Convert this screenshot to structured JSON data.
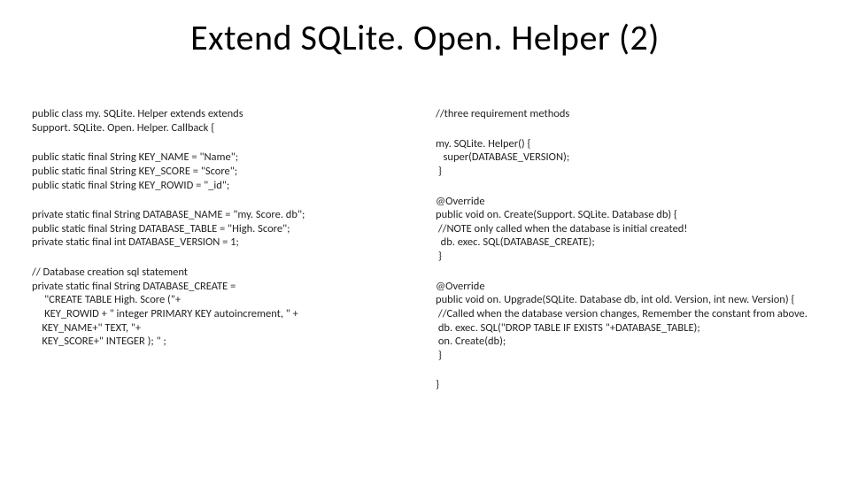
{
  "slide": {
    "title": "Extend SQLite. Open. Helper (2)",
    "left": {
      "p1": "public class my. SQLite. Helper extends extends\nSupport. SQLite. Open. Helper. Callback {",
      "p2": "public static final String KEY_NAME = \"Name\";\npublic static final String KEY_SCORE = \"Score\";\npublic static final String KEY_ROWID = \"_id\";",
      "p3": "private static final String DATABASE_NAME = \"my. Score. db\";\npublic static final String DATABASE_TABLE = \"High. Score\";\nprivate static final int DATABASE_VERSION = 1;",
      "p4": "// Database creation sql statement\nprivate static final String DATABASE_CREATE =\n     \"CREATE TABLE High. Score (\"+\n     KEY_ROWID + \" integer PRIMARY KEY autoincrement, \" +\n    KEY_NAME+\" TEXT, \"+\n    KEY_SCORE+\" INTEGER ); \" ;"
    },
    "right": {
      "p1": "//three requirement methods",
      "p2": "my. SQLite. Helper() {\n   super(DATABASE_VERSION);\n }",
      "p3": "@Override\npublic void on. Create(Support. SQLite. Database db) {\n //NOTE only called when the database is initial created!\n  db. exec. SQL(DATABASE_CREATE);\n }",
      "p4": "@Override\npublic void on. Upgrade(SQLite. Database db, int old. Version, int new. Version) {\n //Called when the database version changes, Remember the constant from above.\n db. exec. SQL(\"DROP TABLE IF EXISTS \"+DATABASE_TABLE);\n on. Create(db);\n }",
      "p5": "}"
    }
  }
}
